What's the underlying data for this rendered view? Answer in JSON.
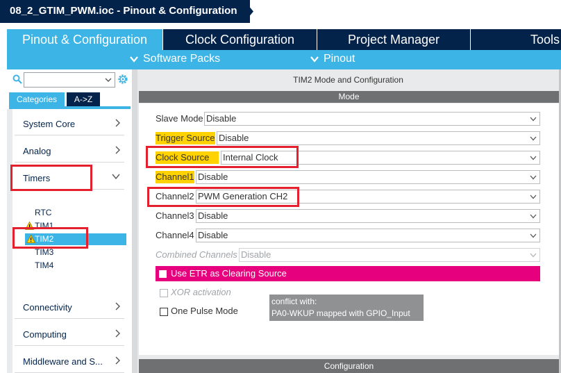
{
  "window": {
    "title": "08_2_GTIM_PWM.ioc - Pinout & Configuration"
  },
  "tabs": [
    {
      "label": "Pinout & Configuration",
      "active": true
    },
    {
      "label": "Clock Configuration",
      "active": false
    },
    {
      "label": "Project Manager",
      "active": false
    },
    {
      "label": "Tools",
      "active": false
    }
  ],
  "subnav": {
    "software_packs": "Software Packs",
    "pinout": "Pinout"
  },
  "left": {
    "search": {
      "value": ""
    },
    "category_tabs": [
      "Categories",
      "A->Z"
    ],
    "categories": [
      {
        "label": "System Core"
      },
      {
        "label": "Analog"
      },
      {
        "label": "Timers"
      },
      {
        "label": "Connectivity"
      },
      {
        "label": "Computing"
      },
      {
        "label": "Middleware and S..."
      }
    ],
    "timers": [
      {
        "label": "RTC",
        "warning": false,
        "selected": false
      },
      {
        "label": "TIM1",
        "warning": true,
        "selected": false
      },
      {
        "label": "TIM2",
        "warning": true,
        "selected": true
      },
      {
        "label": "TIM3",
        "warning": false,
        "selected": false
      },
      {
        "label": "TIM4",
        "warning": false,
        "selected": false
      }
    ]
  },
  "panel": {
    "title": "TIM2 Mode and Configuration",
    "mode_header": "Mode",
    "config_header": "Configuration",
    "fields": [
      {
        "label": "Slave Mode",
        "value": "Disable",
        "highlight": false,
        "disabled": false
      },
      {
        "label": "Trigger Source",
        "value": "Disable",
        "highlight": true,
        "disabled": false
      },
      {
        "label": "Clock Source",
        "value": "Internal Clock",
        "highlight": true,
        "disabled": false
      },
      {
        "label": "Channel1",
        "value": "Disable",
        "highlight": true,
        "disabled": false
      },
      {
        "label": "Channel2",
        "value": "PWM Generation CH2",
        "highlight": false,
        "disabled": false
      },
      {
        "label": "Channel3",
        "value": "Disable",
        "highlight": false,
        "disabled": false
      },
      {
        "label": "Channel4",
        "value": "Disable",
        "highlight": false,
        "disabled": false
      },
      {
        "label": "Combined Channels",
        "value": "Disable",
        "highlight": false,
        "disabled": true
      }
    ],
    "etr_clearing": {
      "label": "Use ETR as Clearing Source",
      "checked": false
    },
    "xor_activation": {
      "label": "XOR activation",
      "checked": false,
      "disabled": true
    },
    "one_pulse": {
      "label": "One Pulse Mode",
      "checked": false
    },
    "tooltip": {
      "line1": "conflict with:",
      "line2": "PA0-WKUP mapped with GPIO_Input"
    }
  },
  "colors": {
    "brand_dark": "#03234b",
    "brand_light": "#3cb4e6",
    "highlight_yellow": "#ffd200",
    "etr_pink": "#e6007e",
    "annotation_red": "#e5202e",
    "warning": "#ffd200"
  }
}
